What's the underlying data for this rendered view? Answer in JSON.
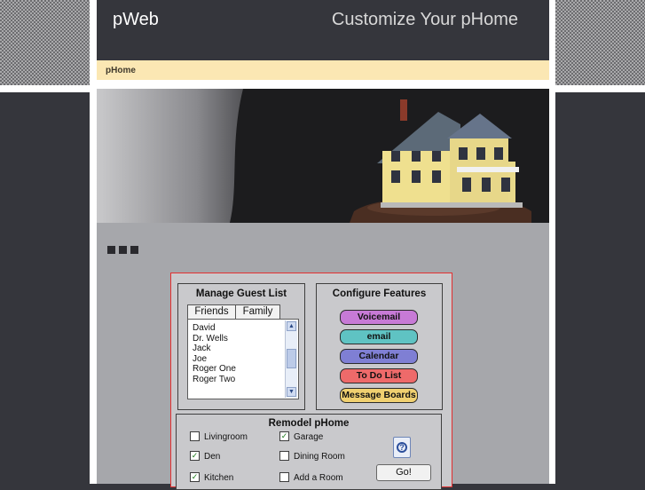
{
  "header": {
    "site_name": "pWeb",
    "slogan": "Customize Your pHome"
  },
  "nav": {
    "items": [
      "pHome"
    ]
  },
  "guest_list": {
    "title": "Manage Guest List",
    "tabs": [
      "Friends",
      "Family"
    ],
    "names": [
      "David",
      "Dr. Wells",
      "Jack",
      "Joe",
      "Roger One",
      "Roger Two"
    ]
  },
  "features": {
    "title": "Configure Features",
    "buttons": [
      {
        "label": "Voicemail",
        "color": "#c77ad6"
      },
      {
        "label": "email",
        "color": "#5fc3c3"
      },
      {
        "label": "Calendar",
        "color": "#7f7fd4"
      },
      {
        "label": "To Do List",
        "color": "#ee6a6a"
      },
      {
        "label": "Message Boards",
        "color": "#f0d070"
      }
    ]
  },
  "remodel": {
    "title": "Remodel pHome",
    "rooms": [
      {
        "label": "Livingroom",
        "checked": false
      },
      {
        "label": "Garage",
        "checked": true
      },
      {
        "label": "Den",
        "checked": true
      },
      {
        "label": "Dining Room",
        "checked": false
      },
      {
        "label": "Kitchen",
        "checked": true
      },
      {
        "label": "Add a Room",
        "checked": false
      }
    ],
    "go_label": "Go!",
    "help_icon": "help-icon"
  }
}
